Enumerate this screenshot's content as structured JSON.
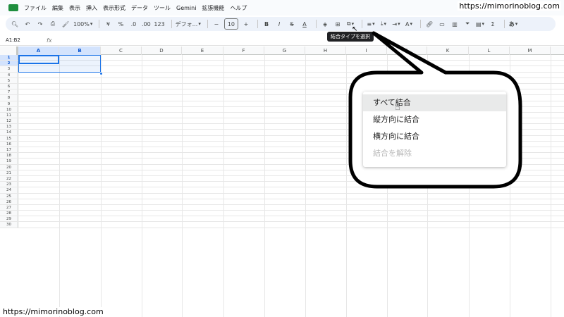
{
  "menubar": {
    "items": [
      "ファイル",
      "編集",
      "表示",
      "挿入",
      "表示形式",
      "データ",
      "ツール",
      "Gemini",
      "拡張機能",
      "ヘルプ"
    ]
  },
  "watermark": "https://mimorinoblog.com",
  "toolbar": {
    "zoom": "100%",
    "currency": "¥",
    "percent": "%",
    "decimal_decrease": ".0",
    "decimal_increase": ".00",
    "number_format": "123",
    "font": "デフォ...",
    "minus": "−",
    "font_size": "10",
    "plus": "+",
    "bold": "B",
    "italic": "I",
    "strikethrough": "S",
    "text_color": "A",
    "sigma": "Σ",
    "input_tool": "あ"
  },
  "tooltip": "結合タイプを選択",
  "formula_bar": {
    "name_box": "A1:B2",
    "fx": "fx"
  },
  "columns": [
    "A",
    "B",
    "C",
    "D",
    "E",
    "F",
    "G",
    "H",
    "I",
    "J",
    "K",
    "L",
    "M"
  ],
  "rows": [
    "1",
    "2",
    "3",
    "4",
    "5",
    "6",
    "7",
    "8",
    "9",
    "10",
    "11",
    "12",
    "13",
    "14",
    "15",
    "16",
    "17",
    "18",
    "19",
    "20",
    "21",
    "22",
    "23",
    "24",
    "25",
    "26",
    "27",
    "28",
    "29",
    "30"
  ],
  "merge_menu": {
    "items": [
      {
        "label": "すべて結合",
        "state": "hover"
      },
      {
        "label": "縦方向に結合",
        "state": "normal"
      },
      {
        "label": "横方向に結合",
        "state": "normal"
      },
      {
        "label": "結合を解除",
        "state": "disabled"
      }
    ]
  }
}
